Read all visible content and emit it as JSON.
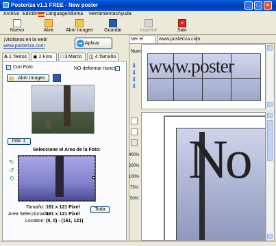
{
  "window": {
    "title": "Posteriza v1.1 FREE - New poster"
  },
  "menu": [
    "Archivo",
    "Edición",
    "Language/Idioma",
    "Herramientas",
    "Ayuda"
  ],
  "toolbar": {
    "nuevo": "Nuevo",
    "abrir": "Abrir",
    "abrir_imagen": "Abrir Imagen",
    "guardar": "Guardar",
    "imprimir": "Imprimir",
    "salir": "Salir"
  },
  "left": {
    "promo": "¡Visitanos en la web!",
    "link": "www.posteriza.com",
    "apply": "Aplicar",
    "tabs": [
      "1.Textos",
      "2.Foto",
      "3.Marco",
      "4.Tamaño"
    ],
    "con_foto": "Con Foto",
    "no_deformar": "NO deformar nunca",
    "abrir_imagen": "Abrir Imagen",
    "mas": "más",
    "select_area_title": "Seleccione el Area de la Foto:",
    "tamano_label": "Tamaño:",
    "tamano_value": "161 x 121 Pixel",
    "area_label": "Area Seleccionada:",
    "area_value": "161 x 121 Pixel",
    "location_label": "Location:",
    "location_value": "(0, 0) - (161, 121)",
    "toda": "Toda"
  },
  "right": {
    "tabs": [
      "Ver el Poster",
      "www.posteriza.com"
    ],
    "num_label": "Num",
    "poster_text": "www.poster",
    "zoom_levels": [
      "400%",
      "200%",
      "100%",
      "75%",
      "50%"
    ],
    "big_letters": "No"
  },
  "colors": {
    "title_bar": "#0a5fe0",
    "apply_button": "#2f8fe0",
    "accent_blue": "#3a7be0"
  }
}
